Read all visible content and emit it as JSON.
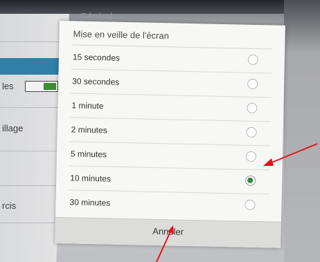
{
  "background": {
    "items": [
      "les",
      "illage",
      "rcis"
    ],
    "header": "Général"
  },
  "dialog": {
    "title": "Mise en veille de l'écran",
    "options": [
      {
        "label": "15 secondes",
        "selected": false
      },
      {
        "label": "30 secondes",
        "selected": false
      },
      {
        "label": "1 minute",
        "selected": false
      },
      {
        "label": "2 minutes",
        "selected": false
      },
      {
        "label": "5 minutes",
        "selected": false
      },
      {
        "label": "10 minutes",
        "selected": true
      },
      {
        "label": "30 minutes",
        "selected": false
      }
    ],
    "cancel_label": "Annuler"
  },
  "colors": {
    "accent_green": "#2f8c3b",
    "annotation_red": "#e0141a",
    "settings_blue": "#2f7fa6"
  },
  "annotations": {
    "arrow_icons": [
      "red-arrow-icon",
      "red-arrow-icon"
    ]
  }
}
